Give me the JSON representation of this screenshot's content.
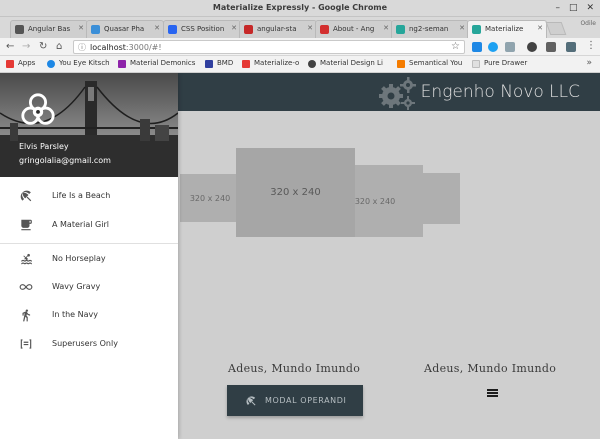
{
  "window": {
    "title": "Materialize Expressly - Google Chrome"
  },
  "tabs": [
    {
      "label": "Angular Bas",
      "color": "#555555"
    },
    {
      "label": "Quasar Pha",
      "color": "#3b8fd8"
    },
    {
      "label": "CSS Position",
      "color": "#2965f1"
    },
    {
      "label": "angular-sta",
      "color": "#c62828"
    },
    {
      "label": "About - Ang",
      "color": "#d32f2f"
    },
    {
      "label": "ng2-seman",
      "color": "#26a69a"
    },
    {
      "label": "Materialize",
      "color": "#26a69a"
    }
  ],
  "profile_label": "Odile",
  "toolbar": {
    "back_icon": "arrow-left-icon",
    "forward_icon": "arrow-right-icon",
    "reload_icon": "reload-icon",
    "home_icon": "home-icon",
    "url_host": "localhost",
    "url_rest": ":3000/#!"
  },
  "bookmarks": [
    {
      "label": "Apps",
      "color": "#e53935"
    },
    {
      "label": "You Eye Kitsch",
      "color": "#1e88e5"
    },
    {
      "label": "Material Demonics",
      "color": "#8e24aa"
    },
    {
      "label": "BMD",
      "color": "#303f9f"
    },
    {
      "label": "Materialize-o",
      "color": "#e53935"
    },
    {
      "label": "Material Design Li",
      "color": "#424242"
    },
    {
      "label": "Semantical You",
      "color": "#f57c00"
    },
    {
      "label": "Pure Drawer",
      "color": "#bdbdbd"
    }
  ],
  "header": {
    "brand": "Engenho Novo LLC"
  },
  "carousel": {
    "center": "320 x 240",
    "left": "320 x 240",
    "right": "320 x 240"
  },
  "cards": [
    {
      "caption": "Adeus, Mundo Imundo"
    },
    {
      "caption": "Adeus, Mundo Imundo"
    }
  ],
  "modal_button": {
    "label": "MODAL OPERANDI",
    "icon": "beach-umbrella-icon"
  },
  "user": {
    "name": "Elvis Parsley",
    "email": "gringolalia@gmail.com"
  },
  "nav": {
    "group1": [
      {
        "label": "Life Is a Beach",
        "icon": "beach-umbrella-icon"
      },
      {
        "label": "A Material Girl",
        "icon": "coffee-icon"
      }
    ],
    "group2": [
      {
        "label": "No Horseplay",
        "icon": "pool-icon"
      },
      {
        "label": "Wavy Gravy",
        "icon": "infinity-icon"
      },
      {
        "label": "In the Navy",
        "icon": "walk-icon"
      },
      {
        "label": "Superusers Only",
        "icon": "admin-icon"
      }
    ]
  }
}
